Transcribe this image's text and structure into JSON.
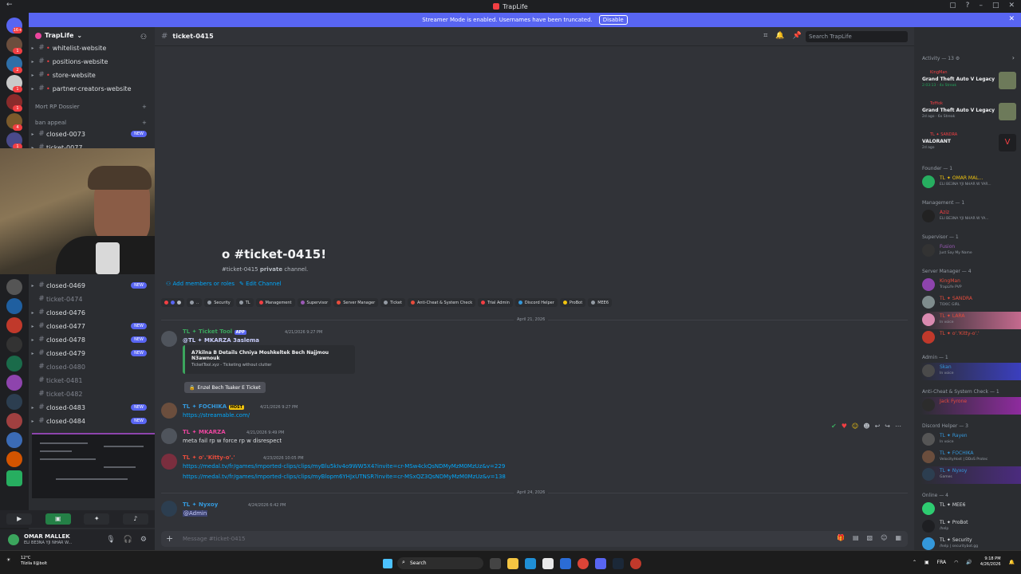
{
  "window": {
    "title": "TrapLife"
  },
  "banner": {
    "text": "Streamer Mode is enabled. Usernames have been truncated.",
    "button": "Disable"
  },
  "guild_badges": [
    "16+",
    "1",
    "2",
    "1",
    "1",
    "4",
    "1"
  ],
  "server": {
    "name": "TrapLife"
  },
  "channels_top": [
    {
      "name": "whitelist-website"
    },
    {
      "name": "positions-website"
    },
    {
      "name": "store-website"
    },
    {
      "name": "partner-creators-website"
    }
  ],
  "categories": {
    "dossier": "Mort RP Dossier",
    "appeal": "ban appeal"
  },
  "channels_tickets": [
    {
      "name": "closed-0073",
      "badge": "NEW"
    },
    {
      "name": "ticket-0077",
      "badge": ""
    },
    {
      "name": "closed-0469",
      "badge": "NEW"
    },
    {
      "name": "ticket-0474",
      "badge": ""
    },
    {
      "name": "closed-0476",
      "badge": ""
    },
    {
      "name": "closed-0477",
      "badge": "NEW"
    },
    {
      "name": "closed-0478",
      "badge": "NEW"
    },
    {
      "name": "closed-0479",
      "badge": "NEW"
    },
    {
      "name": "closed-0480",
      "badge": ""
    },
    {
      "name": "ticket-0481",
      "badge": ""
    },
    {
      "name": "ticket-0482",
      "badge": ""
    },
    {
      "name": "closed-0483",
      "badge": "NEW"
    },
    {
      "name": "closed-0484",
      "badge": "NEW"
    }
  ],
  "user": {
    "name": "OMAR MALLEK",
    "status": "ELI BE3NA YJI NHAR W..."
  },
  "chat": {
    "channel": "ticket-0415",
    "search_placeholder": "Search TrapLife",
    "welcome_title": "o #ticket-0415!",
    "welcome_sub_channel": "#ticket-0415",
    "welcome_sub_bold": "private",
    "welcome_sub_end": "channel.",
    "add_members": "Add members or roles",
    "edit_channel": "Edit Channel",
    "roles": [
      {
        "name": "Security",
        "color": "#949ba4"
      },
      {
        "name": "TL",
        "color": "#949ba4"
      },
      {
        "name": "Management",
        "color": "#f23f43"
      },
      {
        "name": "Supervisor",
        "color": "#9b59b6"
      },
      {
        "name": "Server Manager",
        "color": "#e74c3c"
      },
      {
        "name": "Ticket",
        "color": "#949ba4"
      },
      {
        "name": "Anti-Cheat & System Check",
        "color": "#e74c3c"
      },
      {
        "name": "Trial Admin",
        "color": "#f23f43"
      },
      {
        "name": "Discord Helper",
        "color": "#3498db"
      },
      {
        "name": "ProBot",
        "color": "#f1c40f"
      },
      {
        "name": "MEE6",
        "color": "#949ba4"
      }
    ],
    "date1": "April 21, 2026",
    "date2": "April 24, 2026",
    "messages": [
      {
        "author": "TL ✦ Ticket Tool",
        "tag": "APP",
        "time": "4/21/2026 9:27 PM",
        "content": "@TL ✦ MKARZA 3aslema"
      },
      {
        "author": "TL ✦ FOCHIKA",
        "tag": "HOST",
        "time": "4/21/2026 9:27 PM",
        "content": "https://streamable.com/"
      },
      {
        "author": "TL ✦ MKARZA",
        "tag": "",
        "time": "4/21/2026 9:49 PM",
        "content": "meta fail rp w force rp w disrespect"
      },
      {
        "author": "TL ✦ o'.'Kitty-o'.'",
        "tag": "TL",
        "time": "4/23/2026 10:05 PM",
        "content": "https://medal.tv/fr/games/imported-clips/clips/myBlu5kIv4o9WW5X4?invite=cr-MSw4ckQsNDMyMzM0MzUz&v=229",
        "content2": "https://medal.tv/fr/games/imported-clips/clips/myBlopm6YHJxUTNSR?invite=cr-MSxQZ3QsNDMyMzM0MzUz&v=138"
      },
      {
        "author": "TL ✦ Nyxoy",
        "tag": "TL",
        "time": "4/24/2026 6:42 PM",
        "content": "@Admin"
      }
    ],
    "embed": {
      "title": "A7kilna B Details Chniya Moshkeltek Bech Najjmou N3awnouk",
      "footer": "TicketTool.xyz - Ticketing without clutter"
    },
    "ticket_button": "Enzel Bech Tsaker E Ticket",
    "composer_placeholder": "Message #ticket-0415"
  },
  "members": {
    "activity_label": "Activity — 13",
    "activities": [
      {
        "name": "KingMan",
        "game": "Grand Theft Auto V Legacy",
        "detail": "2:03:13 · 4x Streak"
      },
      {
        "name": "Toffiok",
        "game": "Grand Theft Auto V Legacy",
        "detail": "2d ago · 6x Streak"
      },
      {
        "name": "TL ✦ SANDRA",
        "game": "VALORANT",
        "detail": "2d ago"
      }
    ],
    "groups": [
      {
        "label": "Founder — 1",
        "members": [
          {
            "name": "TL ✦ OMAR MAL...",
            "status": "ELI BE3NA YJI NHAR W YAR...",
            "color": "#f1c40f"
          }
        ]
      },
      {
        "label": "Management — 1",
        "members": [
          {
            "name": "Aziz",
            "status": "ELI BE3NA YJI NHAR W YA...",
            "color": "#f23f43"
          }
        ]
      },
      {
        "label": "Supervisor — 1",
        "members": [
          {
            "name": "Fusion",
            "status": "Just Say My Name",
            "color": "#9b59b6"
          }
        ]
      },
      {
        "label": "Server Manager — 4",
        "members": [
          {
            "name": "KingMan",
            "status": "TrapLife PVP",
            "color": "#e74c3c"
          },
          {
            "name": "TL ✦ SANDRA",
            "status": "TOXIC GIRL",
            "color": "#e74c3c"
          },
          {
            "name": "TL ✦ LARA",
            "status": "In voice",
            "color": "#e74c3c"
          },
          {
            "name": "TL ✦ o'.'Kitty-o'.'",
            "status": "",
            "color": "#e74c3c"
          }
        ]
      },
      {
        "label": "Admin — 1",
        "members": [
          {
            "name": "Skan",
            "status": "In voice",
            "color": "#3498db"
          }
        ]
      },
      {
        "label": "Anti-Cheat & System Check — 1",
        "members": [
          {
            "name": "Jack Fyrone",
            "status": "",
            "color": "#e74c3c"
          }
        ]
      },
      {
        "label": "Discord Helper — 3",
        "members": [
          {
            "name": "TL ✦ Rayen",
            "status": "In voice",
            "color": "#3498db"
          },
          {
            "name": "TL ✦ FOCHIKA",
            "status": "VelocityHost | DDoS Protec",
            "color": "#3498db"
          },
          {
            "name": "TL ✦ Nyxoy",
            "status": "Games",
            "color": "#3498db"
          }
        ]
      },
      {
        "label": "Online — 4",
        "members": [
          {
            "name": "TL ✦ MEE6",
            "status": "",
            "color": "#dbdee1"
          },
          {
            "name": "TL ✦ ProBot",
            "status": "/help",
            "color": "#dbdee1"
          },
          {
            "name": "TL ✦ Security",
            "status": "/help | securitybot.gg",
            "color": "#dbdee1"
          }
        ]
      }
    ]
  },
  "taskbar": {
    "temp": "12°C",
    "weather": "Tilzila ll@bolt",
    "search": "Search",
    "lang": "FRA",
    "time": "9:18 PM",
    "date": "4/26/2026"
  }
}
